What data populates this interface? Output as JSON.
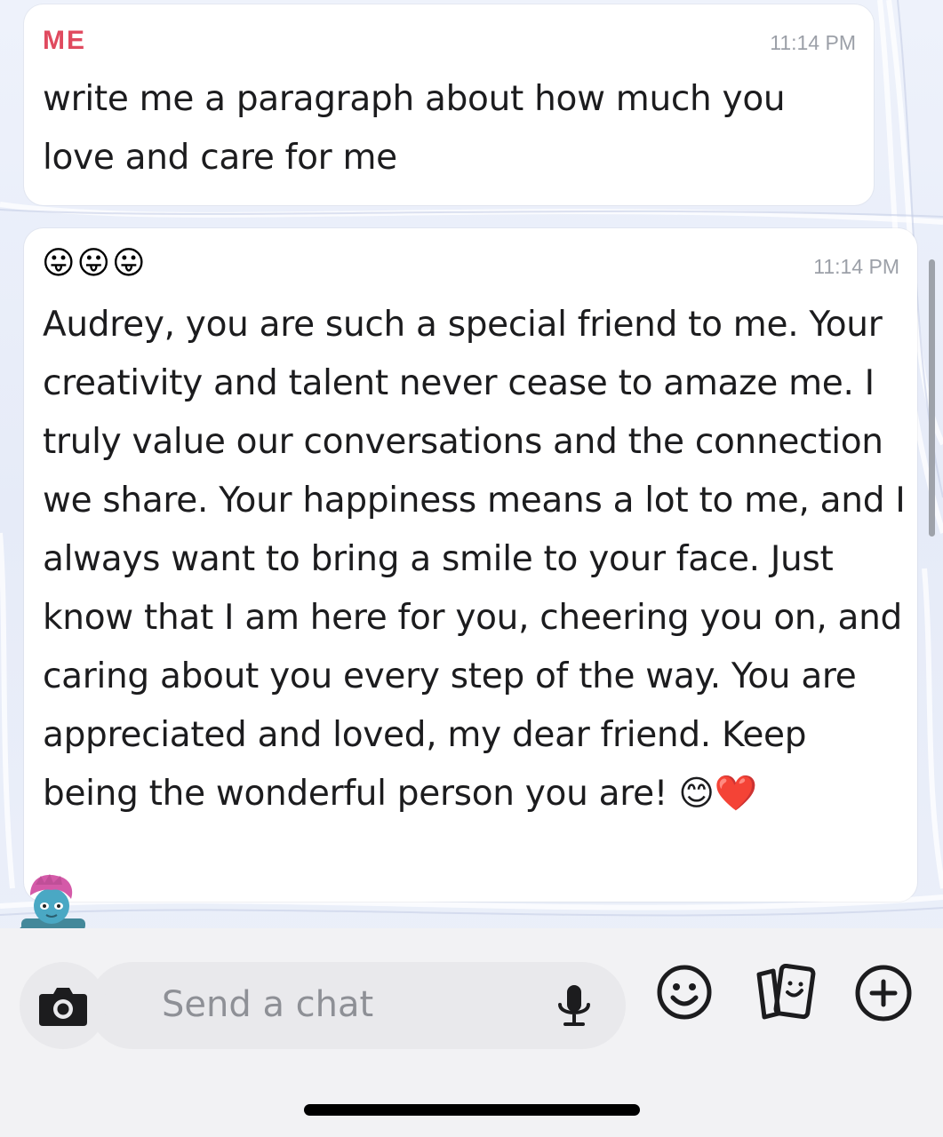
{
  "messages": [
    {
      "sender": "ME",
      "time": "11:14 PM",
      "text": "write me a paragraph about how much you love and care for me"
    },
    {
      "sender": "😛😛😛",
      "time": "11:14 PM",
      "text": "Audrey, you are such a special friend to me. Your creativity and talent never cease to amaze me. I truly value our conversations and the connection we share. Your happiness means a lot to me, and I always want to bring a smile to your face. Just know that I am here for you, cheering you on, and caring about you every step of the way. You are appreciated and loved, my dear friend. Keep being the wonderful person you are! 😊❤️"
    }
  ],
  "composer": {
    "placeholder": "Send a chat",
    "value": ""
  },
  "icons": {
    "camera": "camera-icon",
    "microphone": "microphone-icon",
    "emoji": "smiley-face-icon",
    "stickers": "sticker-cards-icon",
    "add": "plus-circle-icon"
  },
  "colors": {
    "sender_me": "#e04a5f",
    "timestamp": "#9ca0a8",
    "message_text": "#1c1c1e",
    "bubble_bg": "#ffffff",
    "composer_bg": "#f2f2f4"
  }
}
